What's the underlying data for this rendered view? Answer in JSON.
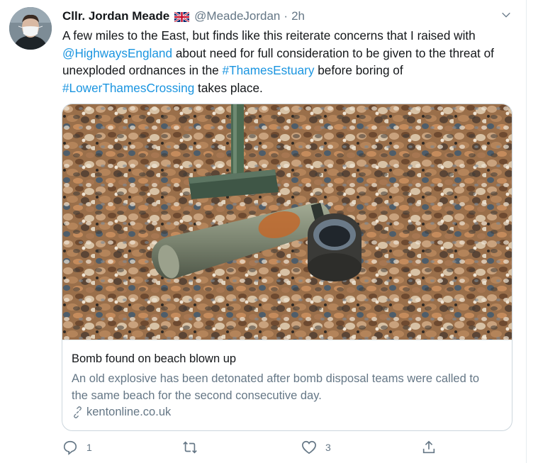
{
  "tweet": {
    "display_name": "Cllr. Jordan Meade",
    "flag_icon": "uk-flag-icon",
    "handle": "@MeadeJordan",
    "separator": "·",
    "time": "2h",
    "text": {
      "p1": "A few miles to the East, but finds like this reiterate concerns that I raised with ",
      "mention": "@HighwaysEngland",
      "p2": " about need for full consideration to be given to the threat of unexploded ordnances in the ",
      "hashtag1": "#ThamesEstuary",
      "p3": " before boring of ",
      "hashtag2": "#LowerThamesCrossing",
      "p4": " takes place."
    },
    "link_color": "#1b95e0"
  },
  "card": {
    "title": "Bomb found on beach blown up",
    "description": "An old explosive has been detonated after bomb disposal teams were called to the same beach for the second consecutive day.",
    "domain": "kentonline.co.uk",
    "domain_icon": "link-icon"
  },
  "actions": {
    "reply_count": "1",
    "retweet_count": "",
    "like_count": "3",
    "reply_icon": "reply-icon",
    "retweet_icon": "retweet-icon",
    "like_icon": "heart-icon",
    "share_icon": "share-icon"
  }
}
